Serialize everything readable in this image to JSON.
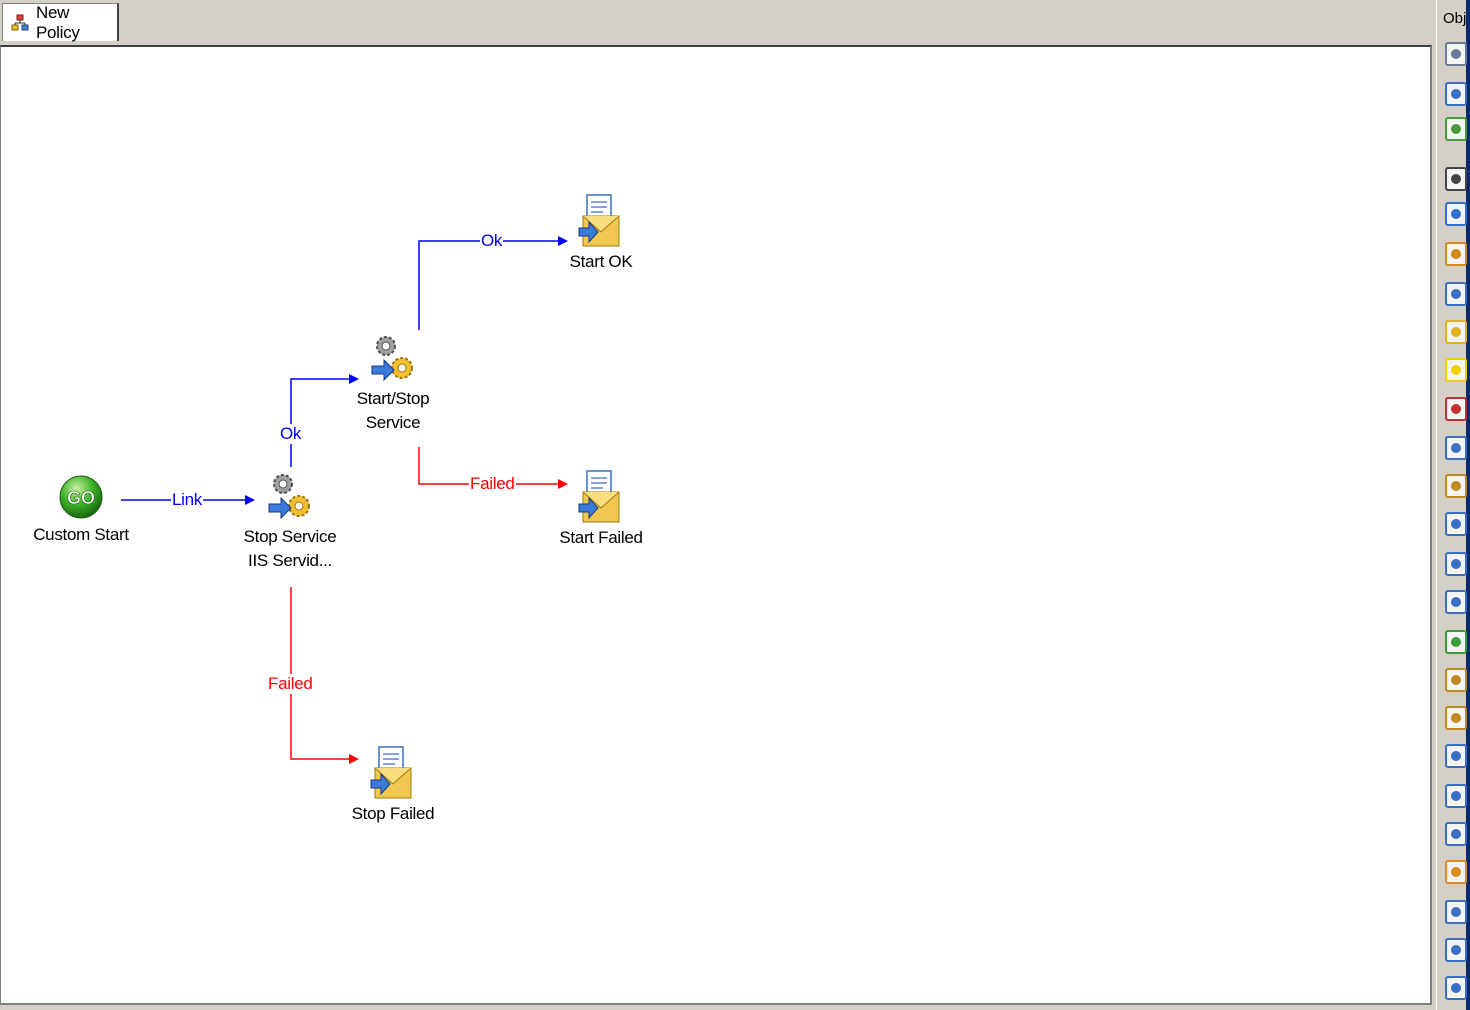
{
  "tab": {
    "label": "New Policy"
  },
  "sidebar": {
    "header": "Obj",
    "tools": [
      {
        "icon": "tools-icon",
        "color": "#6b7a99"
      },
      {
        "icon": "email-delete-icon",
        "color": "#3a6fc4"
      },
      {
        "icon": "network-icon",
        "color": "#4a9c3a"
      },
      {
        "icon": "pause-icon",
        "color": "#444444"
      },
      {
        "icon": "window-icon",
        "color": "#2f6fd0"
      },
      {
        "icon": "pie-chart-icon",
        "color": "#d08a1a"
      },
      {
        "icon": "document-arrow-icon",
        "color": "#3a6fc4"
      },
      {
        "icon": "email-icon",
        "color": "#e0b020"
      },
      {
        "icon": "warning-icon",
        "color": "#f0d000"
      },
      {
        "icon": "toolbox-icon",
        "color": "#c03030"
      },
      {
        "icon": "document-search-icon",
        "color": "#3a6fc4"
      },
      {
        "icon": "briefcase-icon",
        "color": "#c08a20"
      },
      {
        "icon": "book-icon",
        "color": "#3a6fc4"
      },
      {
        "icon": "chart-doc-icon",
        "color": "#3a6fc4"
      },
      {
        "icon": "copy-icon",
        "color": "#3a6fc4"
      },
      {
        "icon": "refresh-icon",
        "color": "#3a9c3a"
      },
      {
        "icon": "briefcase-icon",
        "color": "#c08a20"
      },
      {
        "icon": "briefcase-icon",
        "color": "#c08a20"
      },
      {
        "icon": "clipboard-icon",
        "color": "#3a6fc4"
      },
      {
        "icon": "clipboard-icon",
        "color": "#3a6fc4"
      },
      {
        "icon": "clipboard-shield-icon",
        "color": "#3a6fc4"
      },
      {
        "icon": "clipboard-tag-icon",
        "color": "#e08a20"
      },
      {
        "icon": "clipboard-clock-icon",
        "color": "#3a6fc4"
      },
      {
        "icon": "clipboard-icon",
        "color": "#3a6fc4"
      },
      {
        "icon": "gear-icon",
        "color": "#3a6fc4"
      }
    ]
  },
  "nodes": {
    "custom_start": {
      "label": "Custom Start",
      "icon": "go-icon"
    },
    "stop_service": {
      "label": "Stop Service\nIIS Servid...",
      "icon": "service-gears-icon"
    },
    "start_stop_service": {
      "label": "Start/Stop\nService",
      "icon": "service-gears-icon"
    },
    "start_ok": {
      "label": "Start OK",
      "icon": "email-document-icon"
    },
    "start_failed": {
      "label": "Start Failed",
      "icon": "email-document-icon"
    },
    "stop_failed": {
      "label": "Stop Failed",
      "icon": "email-document-icon"
    }
  },
  "links": {
    "start_to_stop": {
      "label": "Link",
      "kind": "link",
      "color": "#0000ff"
    },
    "stop_to_startstop": {
      "label": "Ok",
      "kind": "ok",
      "color": "#0000ff"
    },
    "stop_to_stopfailed": {
      "label": "Failed",
      "kind": "failed",
      "color": "#ff0000"
    },
    "startstop_to_ok": {
      "label": "Ok",
      "kind": "ok",
      "color": "#0000ff"
    },
    "startstop_to_failed": {
      "label": "Failed",
      "kind": "failed",
      "color": "#ff0000"
    }
  }
}
